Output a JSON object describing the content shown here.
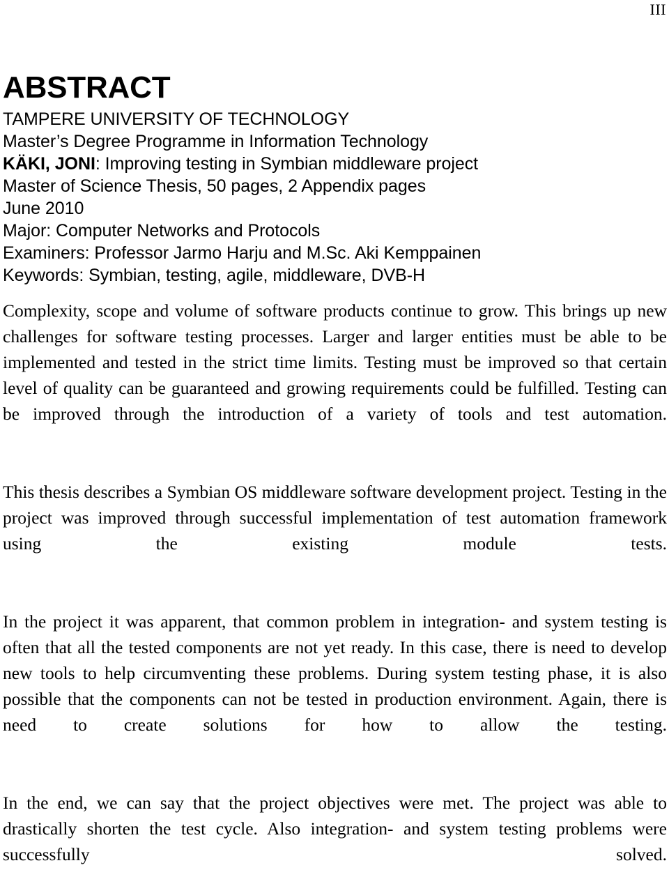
{
  "document": {
    "page_number": "III",
    "heading": "ABSTRACT"
  },
  "metadata": {
    "lines": [
      {
        "text": "TAMPERE UNIVERSITY OF TECHNOLOGY",
        "bold_prefix": ""
      },
      {
        "text": "Master’s Degree Programme in Information Technology",
        "bold_prefix": ""
      },
      {
        "text": ": Improving testing in Symbian middleware project",
        "bold_prefix": "KÄKI, JONI"
      },
      {
        "text": "Master of Science Thesis, 50 pages, 2 Appendix pages",
        "bold_prefix": ""
      },
      {
        "text": "June 2010",
        "bold_prefix": ""
      },
      {
        "text": "Major: Computer Networks and Protocols",
        "bold_prefix": ""
      },
      {
        "text": "Examiners: Professor Jarmo Harju and M.Sc. Aki Kemppainen",
        "bold_prefix": ""
      },
      {
        "text": "Keywords: Symbian, testing, agile, middleware, DVB-H",
        "bold_prefix": ""
      }
    ]
  },
  "body": {
    "paragraphs": [
      "Complexity, scope and volume of software products continue to grow. This brings up new challenges for software testing processes. Larger and larger entities must be able to be implemented and tested in the strict time limits. Testing must be improved so that certain level of quality can be guaranteed and growing requirements could be fulfilled. Testing can be improved through the introduction of a variety of tools and test automation.",
      "This thesis describes a Symbian OS middleware software development project. Testing in the project was improved through successful implementation of test automation framework using the existing module tests.",
      "In the project it was apparent, that common problem in integration- and system testing is often that all the tested components are not yet ready. In this case, there is need to develop new tools to help circumventing these problems. During system testing phase, it is also possible that the components can not be tested in production environment. Again, there is need to create solutions for how to allow the testing.",
      "In the end, we can say that the project objectives were met. The project was able to drastically shorten the test cycle. Also integration- and system testing problems were successfully solved."
    ]
  }
}
